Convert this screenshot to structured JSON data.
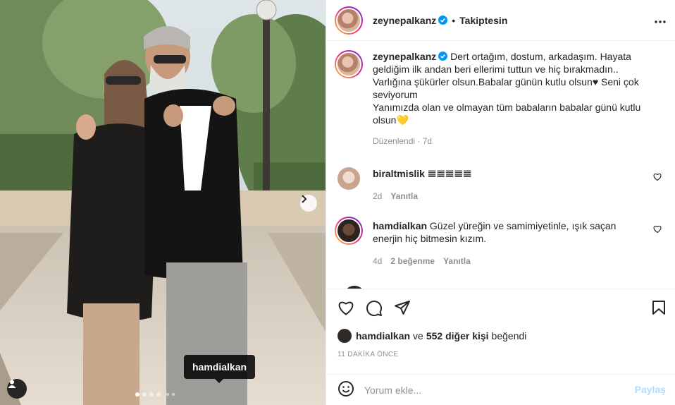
{
  "post": {
    "author": "zeynepalkanz",
    "header_separator": "•",
    "follow_state": "Takiptesin",
    "caption": "Dert ortağım, dostum, arkadaşım. Hayata geldiğim ilk andan beri ellerimi tuttun ve hiç bırakmadın.. Varlığına şükürler olsun.Babalar günün kutlu olsun♥︎ Seni çok seviyorum",
    "caption_line2": "Yanımızda olan ve olmayan tüm babaların babalar günü kutlu olsun💛",
    "caption_meta": "Düzenlendi · 7d"
  },
  "photo": {
    "tag_username": "hamdialkan",
    "slide_count": 6,
    "active_slide": 1
  },
  "comments": [
    {
      "username": "biraltmislik",
      "text": "𝌆𝌆𝌆𝌆𝌆",
      "age": "2d",
      "reply": "Yanıtla"
    },
    {
      "username": "hamdialkan",
      "text": "Güzel yüreğin ve samimiyetinle, ışık saçan enerjin hiç bitmesin kızım.",
      "age": "4d",
      "likes": "2 beğenme",
      "reply": "Yanıtla"
    }
  ],
  "likes_line": {
    "user": "hamdialkan",
    "connector": "ve",
    "others": "552 diğer kişi",
    "suffix": "beğendi"
  },
  "time_ago": "11 DAKİKA ÖNCE",
  "composer": {
    "placeholder": "Yorum ekle...",
    "post_label": "Paylaş"
  },
  "colors": {
    "verified": "#0095f6",
    "post_button_disabled": "#b3dbff",
    "secondary_text": "#8e8e8e"
  },
  "icons": [
    "chevron-right-icon",
    "user-tag-icon",
    "more-icon",
    "heart-icon",
    "comment-icon",
    "share-icon",
    "bookmark-icon",
    "emoji-icon",
    "verified-icon"
  ]
}
